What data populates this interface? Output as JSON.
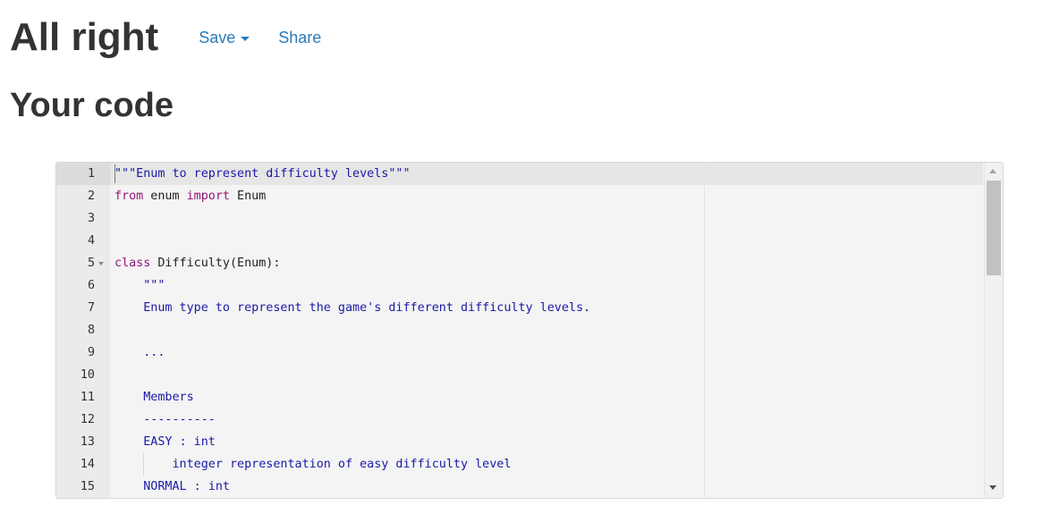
{
  "header": {
    "title": "All right",
    "save_label": "Save",
    "share_label": "Share"
  },
  "section": {
    "title": "Your code"
  },
  "editor": {
    "lines": [
      {
        "number": "1",
        "tokens": [
          {
            "t": "\"\"\"Enum to represent difficulty levels\"\"\"",
            "c": "string"
          }
        ]
      },
      {
        "number": "2",
        "tokens": [
          {
            "t": "from",
            "c": "keyword"
          },
          {
            "t": " enum ",
            "c": "plain"
          },
          {
            "t": "import",
            "c": "keyword"
          },
          {
            "t": " Enum",
            "c": "plain"
          }
        ]
      },
      {
        "number": "3",
        "tokens": []
      },
      {
        "number": "4",
        "tokens": []
      },
      {
        "number": "5",
        "fold": true,
        "tokens": [
          {
            "t": "class",
            "c": "keyword"
          },
          {
            "t": " Difficulty(Enum):",
            "c": "plain"
          }
        ]
      },
      {
        "number": "6",
        "tokens": [
          {
            "t": "    \"\"\"",
            "c": "string"
          }
        ]
      },
      {
        "number": "7",
        "tokens": [
          {
            "t": "    Enum type to represent the game's different difficulty levels.",
            "c": "string"
          }
        ]
      },
      {
        "number": "8",
        "tokens": []
      },
      {
        "number": "9",
        "tokens": [
          {
            "t": "    ...",
            "c": "string"
          }
        ]
      },
      {
        "number": "10",
        "tokens": []
      },
      {
        "number": "11",
        "tokens": [
          {
            "t": "    Members",
            "c": "string"
          }
        ]
      },
      {
        "number": "12",
        "tokens": [
          {
            "t": "    ----------",
            "c": "string"
          }
        ]
      },
      {
        "number": "13",
        "tokens": [
          {
            "t": "    EASY : int",
            "c": "string"
          }
        ]
      },
      {
        "number": "14",
        "guide": true,
        "tokens": [
          {
            "t": "        integer representation of easy difficulty level",
            "c": "string"
          }
        ]
      },
      {
        "number": "15",
        "tokens": [
          {
            "t": "    NORMAL : int",
            "c": "string"
          }
        ]
      }
    ]
  },
  "icons": {
    "save_caret": "caret-down-icon",
    "fold": "fold-arrow-icon",
    "scroll_up": "scroll-up-arrow-icon",
    "scroll_down": "scroll-down-arrow-icon"
  },
  "colors": {
    "link": "#2a7ab8",
    "string": "#1a1aa6",
    "keyword": "#93147a"
  }
}
